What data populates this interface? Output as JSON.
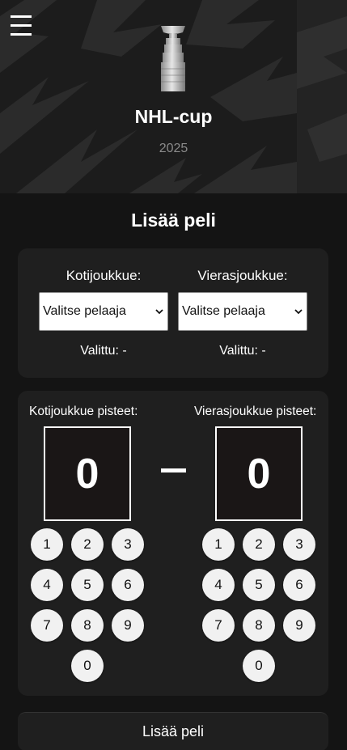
{
  "header": {
    "menu_icon": "hamburger-icon",
    "trophy_icon": "stanley-cup-icon",
    "title": "NHL-cup",
    "year": "2025"
  },
  "add_game": {
    "title": "Lisää peli",
    "home": {
      "label": "Kotijoukkue:",
      "select_value": "Valitse pelaaja",
      "selected_text": "Valittu: -"
    },
    "away": {
      "label": "Vierasjoukkue:",
      "select_value": "Valitse pelaaja",
      "selected_text": "Valittu: -"
    }
  },
  "scores": {
    "home_label": "Kotijoukkue pisteet:",
    "away_label": "Vierasjoukkue pisteet:",
    "home_score": "0",
    "away_score": "0",
    "separator": "–",
    "keypad": [
      "1",
      "2",
      "3",
      "4",
      "5",
      "6",
      "7",
      "8",
      "9",
      "0"
    ]
  },
  "submit_label": "Lisää peli",
  "colors": {
    "background": "#141414",
    "card": "#1f1f1f",
    "key": "#f1f1f1"
  }
}
